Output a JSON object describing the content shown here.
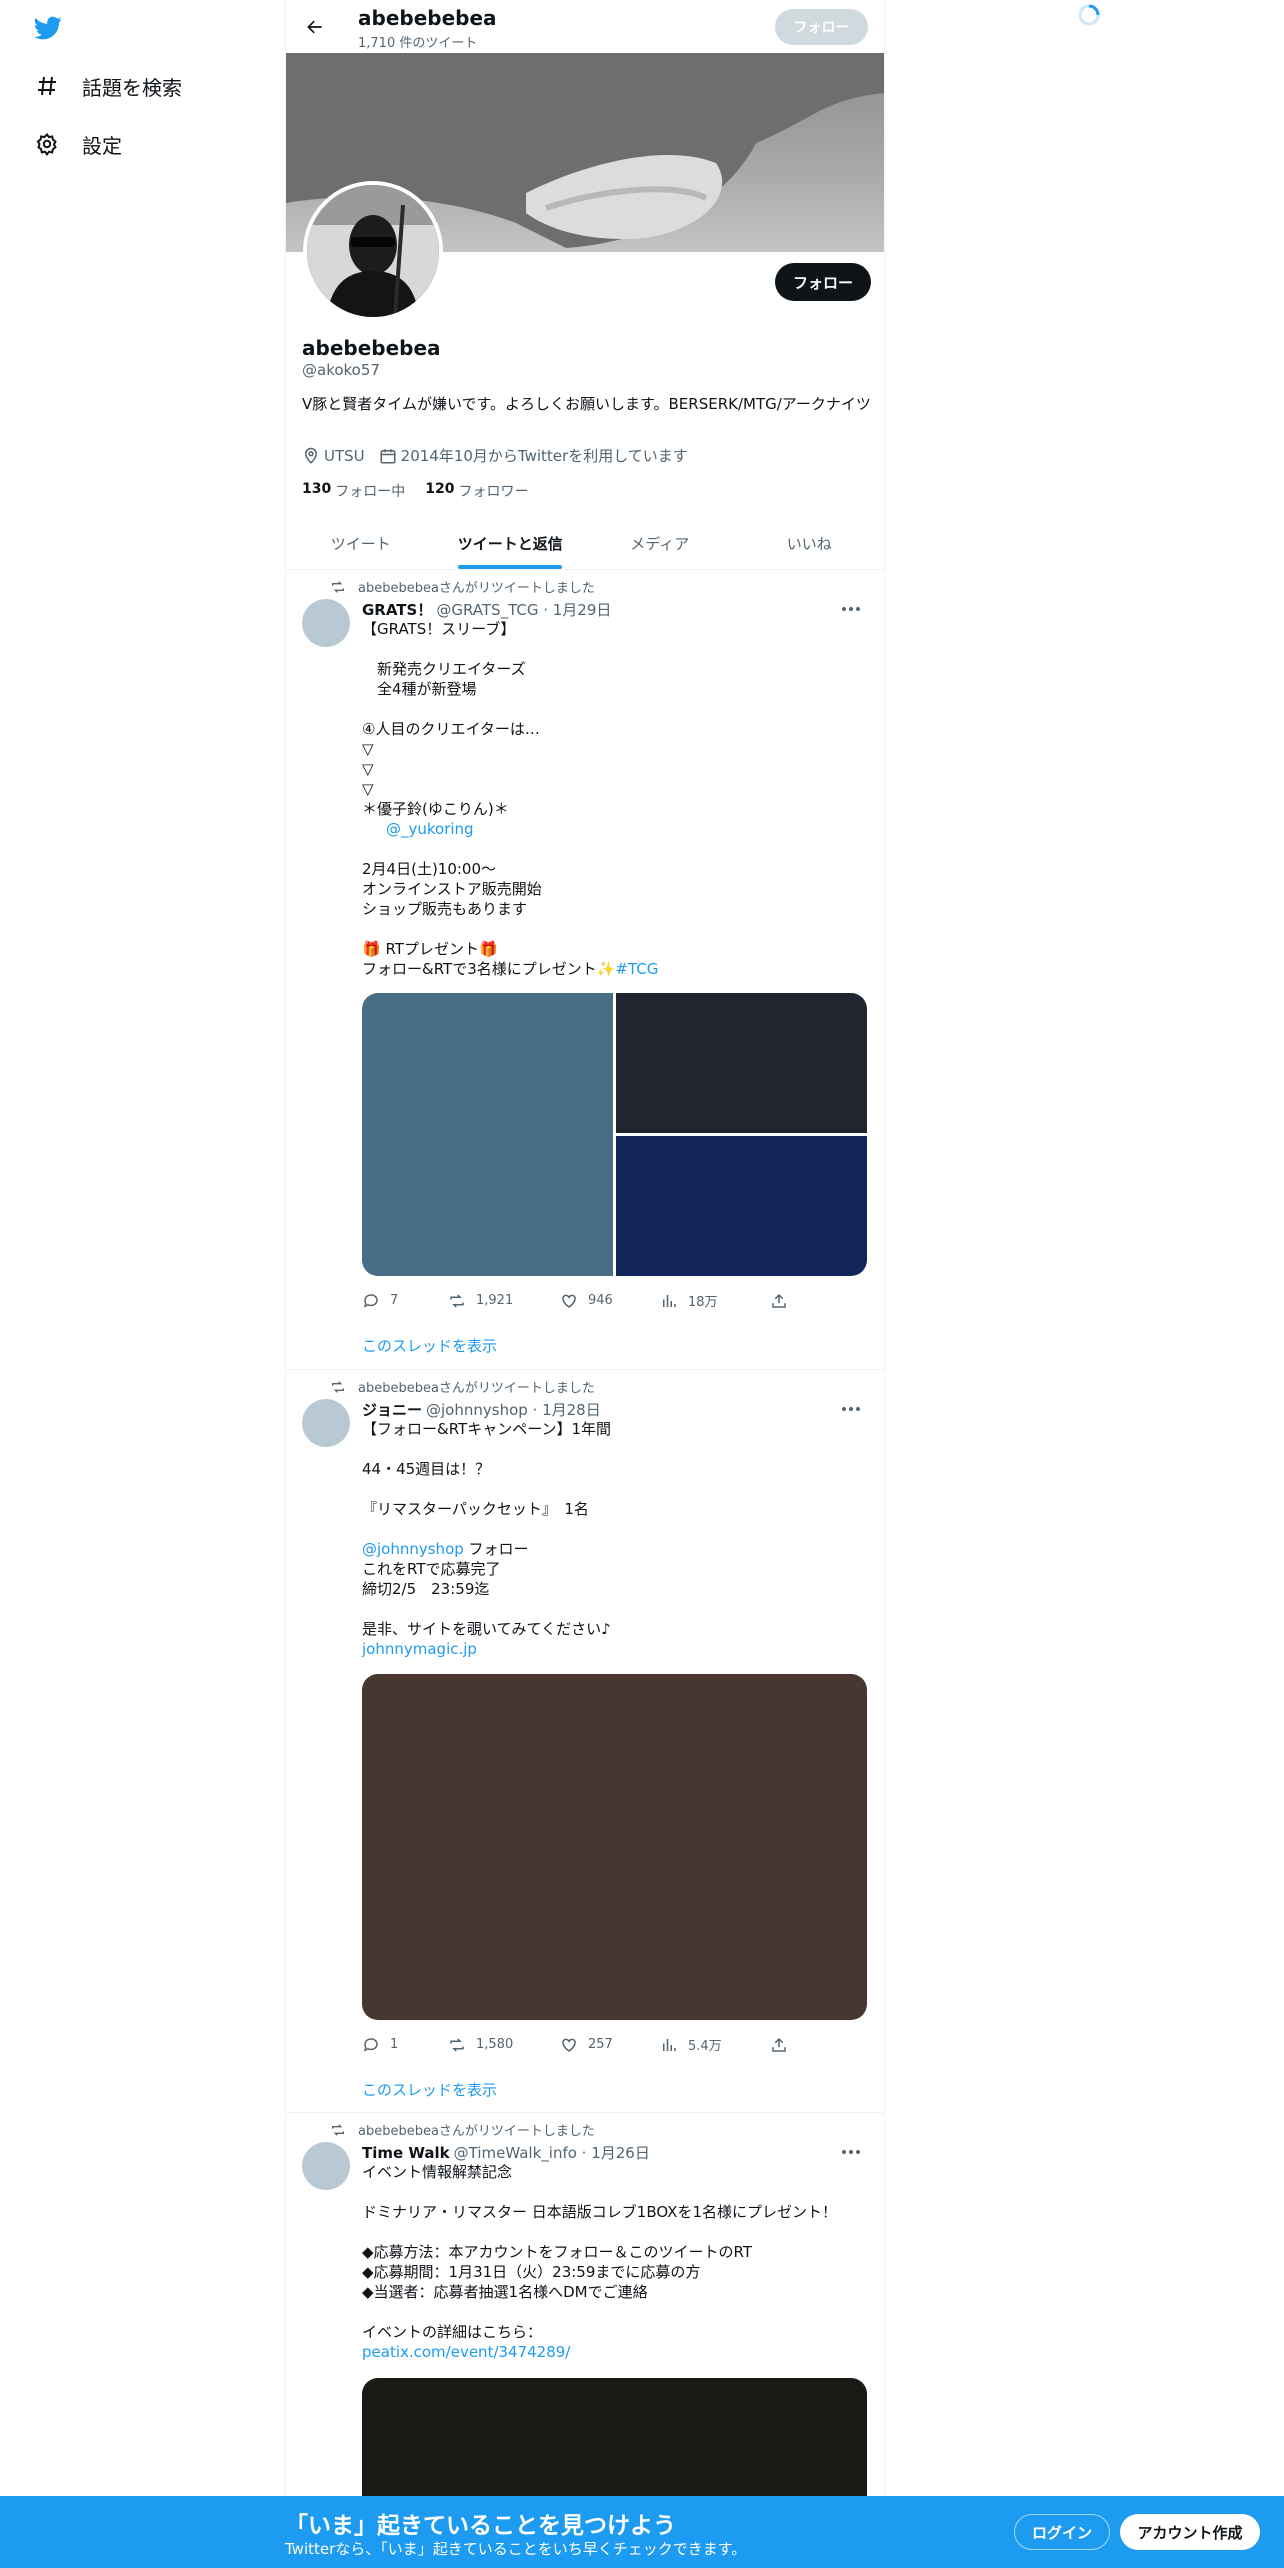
{
  "nav": {
    "items": [
      {
        "label": "話題を検索",
        "icon": "hashtag-icon"
      },
      {
        "label": "設定",
        "icon": "gear-icon"
      }
    ]
  },
  "header": {
    "name": "abebebebea",
    "tweet_count": "1,710 件のツイート",
    "follow_label": "フォロー"
  },
  "profile": {
    "name": "abebebebea",
    "handle": "@akoko57",
    "bio": "V豚と賢者タイムが嫌いです。よろしくお願いします。BERSERK/MTG/アークナイツ",
    "location": "UTSU",
    "joined": "2014年10月からTwitterを利用しています",
    "following_count": "130",
    "following_label": "フォロー中",
    "followers_count": "120",
    "followers_label": "フォロワー",
    "follow_button": "フォロー"
  },
  "tabs": [
    {
      "label": "ツイート",
      "active": false
    },
    {
      "label": "ツイートと返信",
      "active": true
    },
    {
      "label": "メディア",
      "active": false
    },
    {
      "label": "いいね",
      "active": false
    }
  ],
  "tweets": [
    {
      "retweet_note": "abebebebeaさんがリツイートしました",
      "name": "GRATS！",
      "meta": "@GRATS_TCG · 1月29日",
      "lines": [
        "【GRATS！スリーブ】",
        "",
        "　新発売クリエイターズ",
        "　全4種が新登場",
        "",
        "④人目のクリエイターは…",
        "▽",
        "▽",
        "▽",
        "＊優子鈴(ゆこりん)＊",
        "",
        "",
        "2月4日(土)10:00～",
        "オンラインストア販売開始",
        "ショップ販売もあります",
        "",
        "🎁 RTプレゼント🎁",
        ""
      ],
      "mention": "@_yukoring",
      "last_line": "フォロー&RTで3名様にプレゼント✨",
      "hashtag": "#TCG",
      "stats": {
        "replies": "7",
        "retweets": "1,921",
        "likes": "946",
        "views": "18万"
      },
      "thread_label": "このスレッドを表示",
      "media_colors": [
        "#496d84",
        "#212530",
        "#13265a"
      ]
    },
    {
      "retweet_note": "abebebebeaさんがリツイートしました",
      "name": "ジョニー",
      "meta": "@johnnyshop · 1月28日",
      "lines": [
        "【フォロー&RTキャンペーン】1年間",
        "",
        "44・45週目は！？",
        "",
        "『リマスターパックセット』　1名",
        "",
        "",
        "これをRTで応募完了",
        "締切2/5　23:59迄",
        "",
        "是非、サイトを覗いてみてください♪"
      ],
      "mention": "@johnnyshop",
      "mention_suffix": " フォロー",
      "link": "johnnymagic.jp",
      "stats": {
        "replies": "1",
        "retweets": "1,580",
        "likes": "257",
        "views": "5.4万"
      },
      "thread_label": "このスレッドを表示",
      "media_color": "#473730"
    },
    {
      "retweet_note": "abebebebeaさんがリツイートしました",
      "name": "Time Walk",
      "meta": "@TimeWalk_info · 1月26日",
      "lines": [
        "イベント情報解禁記念",
        "",
        "ドミナリア・リマスター 日本語版コレブ1BOXを1名様にプレゼント！",
        "",
        "◆応募方法：本アカウントをフォロー＆このツイートのRT",
        "◆応募期間：1月31日（火）23:59までに応募の方",
        "◆当選者：応募者抽選1名様へDMでご連絡",
        "",
        "イベントの詳細はこちら："
      ],
      "link": "peatix.com/event/3474289/",
      "media_color": "#1a1a16"
    }
  ],
  "bottom_bar": {
    "title": "「いま」起きていることを見つけよう",
    "subtitle": "Twitterなら、「いま」起きていることをいち早くチェックできます。",
    "login": "ログイン",
    "signup": "アカウント作成"
  }
}
